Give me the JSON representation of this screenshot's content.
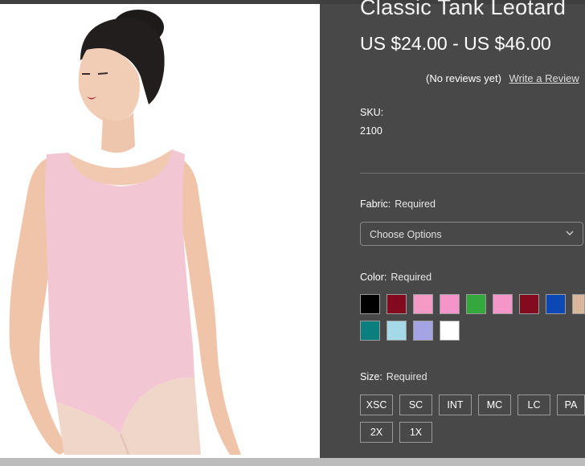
{
  "product": {
    "title": "Classic Tank Leotard",
    "price": "US $24.00 - US $46.00",
    "reviews_text": "(No reviews yet)",
    "write_review": "Write a Review",
    "sku_label": "SKU:",
    "sku_value": "2100"
  },
  "fabric": {
    "label": "Fabric:",
    "required": "Required",
    "selected": "Choose Options"
  },
  "color": {
    "label": "Color:",
    "required": "Required",
    "swatches": [
      "#000000",
      "#820a1e",
      "#f39ac5",
      "#f594c8",
      "#34a83c",
      "#f596c8",
      "#840a1e",
      "#0b47b5",
      "#d9b79a",
      "#0a7f7d",
      "#a6d9e8",
      "#a4a3e3",
      "#ffffff"
    ]
  },
  "size": {
    "label": "Size:",
    "required": "Required",
    "options": [
      "XSC",
      "SC",
      "INT",
      "MC",
      "LC",
      "PA",
      "2X",
      "1X"
    ]
  },
  "colors": {
    "background": "#484848",
    "image_background": "#ffffff",
    "leotard": "#f3c6d4"
  }
}
